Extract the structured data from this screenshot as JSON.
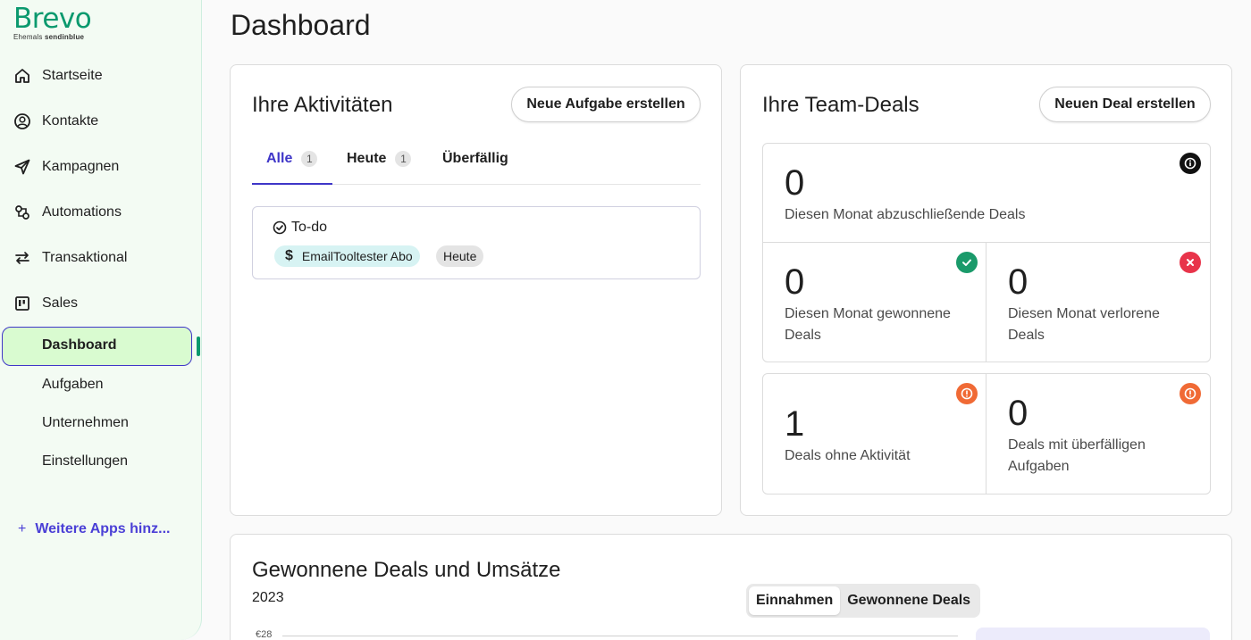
{
  "brand": {
    "name": "Brevo",
    "subtitle_prefix": "Ehemals",
    "subtitle_name": "sendinblue",
    "color": "#0b996e"
  },
  "sidebar": {
    "items": [
      {
        "label": "Startseite",
        "icon": "home-icon"
      },
      {
        "label": "Kontakte",
        "icon": "contact-icon"
      },
      {
        "label": "Kampagnen",
        "icon": "send-icon"
      },
      {
        "label": "Automations",
        "icon": "automation-icon"
      },
      {
        "label": "Transaktional",
        "icon": "transfer-icon"
      },
      {
        "label": "Sales",
        "icon": "board-icon"
      }
    ],
    "sales_sub": {
      "active": "Dashboard",
      "items": [
        "Aufgaben",
        "Unternehmen",
        "Einstellungen"
      ]
    },
    "more_apps": "Weitere Apps hinz..."
  },
  "page": {
    "title": "Dashboard"
  },
  "activities": {
    "title": "Ihre Aktivitäten",
    "button": "Neue Aufgabe erstellen",
    "tabs": [
      {
        "label": "Alle",
        "count": "1"
      },
      {
        "label": "Heute",
        "count": "1"
      },
      {
        "label": "Überfällig"
      }
    ],
    "todo": {
      "title": "To-do",
      "deal": "EmailTooltester Abo",
      "date": "Heute"
    }
  },
  "team_deals": {
    "title": "Ihre Team-Deals",
    "button": "Neuen Deal erstellen",
    "stats": {
      "closing": {
        "value": "0",
        "label": "Diesen Monat abzuschließende Deals"
      },
      "won": {
        "value": "0",
        "label_1": "Diesen Monat gewonnene",
        "label_2": "Deals"
      },
      "lost": {
        "value": "0",
        "label_1": "Diesen Monat verlorene",
        "label_2": "Deals"
      },
      "inactive": {
        "value": "1",
        "label": "Deals ohne Aktivität"
      },
      "overdue": {
        "value": "0",
        "label_1": "Deals mit überfälligen",
        "label_2": "Aufgaben"
      }
    },
    "colors": {
      "won": "#1a9a6a",
      "lost": "#e8344a",
      "warning": "#f06a35",
      "info": "#111111"
    }
  },
  "revenue": {
    "title": "Gewonnene Deals und Umsätze",
    "year": "2023",
    "toggle": [
      "Einnahmen",
      "Gewonnene Deals"
    ],
    "toggle_selected": "Einnahmen",
    "axis_label": "€28"
  }
}
